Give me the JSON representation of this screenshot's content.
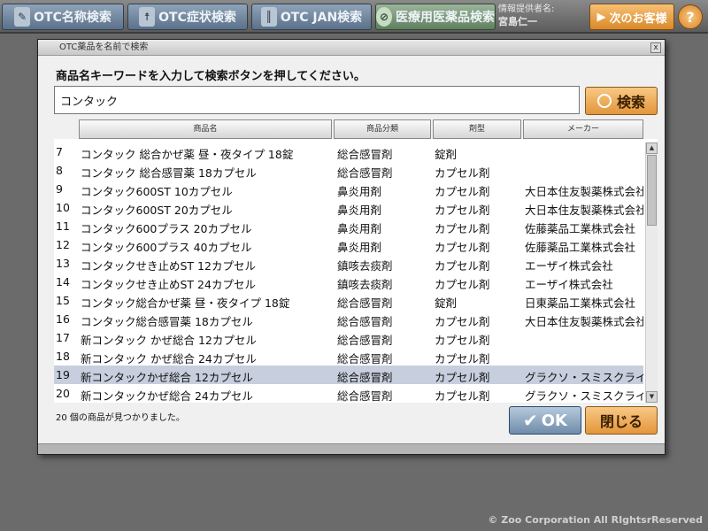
{
  "topbar": {
    "buttons": [
      {
        "label": "OTC名称検索",
        "icon": "pill-icon"
      },
      {
        "label": "OTC症状検索",
        "icon": "person-icon"
      },
      {
        "label": "OTC JAN検索",
        "icon": "barcode-icon"
      },
      {
        "label": "医療用医薬品検索",
        "icon": "capsule-icon"
      }
    ],
    "info_label": "情報提供者名:",
    "info_name": "宮島仁一",
    "next_label": "次のお客様",
    "help_label": "?"
  },
  "dialog": {
    "title": "OTC薬品を名前で検索",
    "close_label": "x",
    "instruction": "商品名キーワードを入力して検索ボタンを押してください。",
    "search_value": "コンタック",
    "search_button": "検索",
    "columns": [
      "商品名",
      "商品分類",
      "剤型",
      "メーカー"
    ],
    "rows": [
      {
        "no": "7",
        "name": "コンタック 総合かぜ薬 昼・夜タイプ 18錠",
        "cat": "総合感冒剤",
        "type": "錠剤",
        "maker": ""
      },
      {
        "no": "8",
        "name": "コンタック 総合感冒薬 18カプセル",
        "cat": "総合感冒剤",
        "type": "カプセル剤",
        "maker": ""
      },
      {
        "no": "9",
        "name": "コンタック600ST 10カプセル",
        "cat": "鼻炎用剤",
        "type": "カプセル剤",
        "maker": "大日本住友製薬株式会社"
      },
      {
        "no": "10",
        "name": "コンタック600ST 20カプセル",
        "cat": "鼻炎用剤",
        "type": "カプセル剤",
        "maker": "大日本住友製薬株式会社"
      },
      {
        "no": "11",
        "name": "コンタック600プラス 20カプセル",
        "cat": "鼻炎用剤",
        "type": "カプセル剤",
        "maker": "佐藤薬品工業株式会社"
      },
      {
        "no": "12",
        "name": "コンタック600プラス 40カプセル",
        "cat": "鼻炎用剤",
        "type": "カプセル剤",
        "maker": "佐藤薬品工業株式会社"
      },
      {
        "no": "13",
        "name": "コンタックせき止めST 12カプセル",
        "cat": "鎮咳去痰剤",
        "type": "カプセル剤",
        "maker": "エーザイ株式会社"
      },
      {
        "no": "14",
        "name": "コンタックせき止めST 24カプセル",
        "cat": "鎮咳去痰剤",
        "type": "カプセル剤",
        "maker": "エーザイ株式会社"
      },
      {
        "no": "15",
        "name": "コンタック総合かぜ薬 昼・夜タイプ 18錠",
        "cat": "総合感冒剤",
        "type": "錠剤",
        "maker": "日東薬品工業株式会社"
      },
      {
        "no": "16",
        "name": "コンタック総合感冒薬 18カプセル",
        "cat": "総合感冒剤",
        "type": "カプセル剤",
        "maker": "大日本住友製薬株式会社"
      },
      {
        "no": "17",
        "name": "新コンタック かぜ総合 12カプセル",
        "cat": "総合感冒剤",
        "type": "カプセル剤",
        "maker": ""
      },
      {
        "no": "18",
        "name": "新コンタック かぜ総合 24カプセル",
        "cat": "総合感冒剤",
        "type": "カプセル剤",
        "maker": ""
      },
      {
        "no": "19",
        "name": "新コンタックかぜ総合 12カプセル",
        "cat": "総合感冒剤",
        "type": "カプセル剤",
        "maker": "グラクソ・スミスクライン株式会社"
      },
      {
        "no": "20",
        "name": "新コンタックかぜ総合 24カプセル",
        "cat": "総合感冒剤",
        "type": "カプセル剤",
        "maker": "グラクソ・スミスクライン株式会社"
      }
    ],
    "selected_no": "19",
    "status": "20 個の商品が見つかりました。",
    "ok_label": "OK",
    "close_button": "閉じる"
  },
  "copyright": "© Zoo Corporation All RIghtsrReserved"
}
